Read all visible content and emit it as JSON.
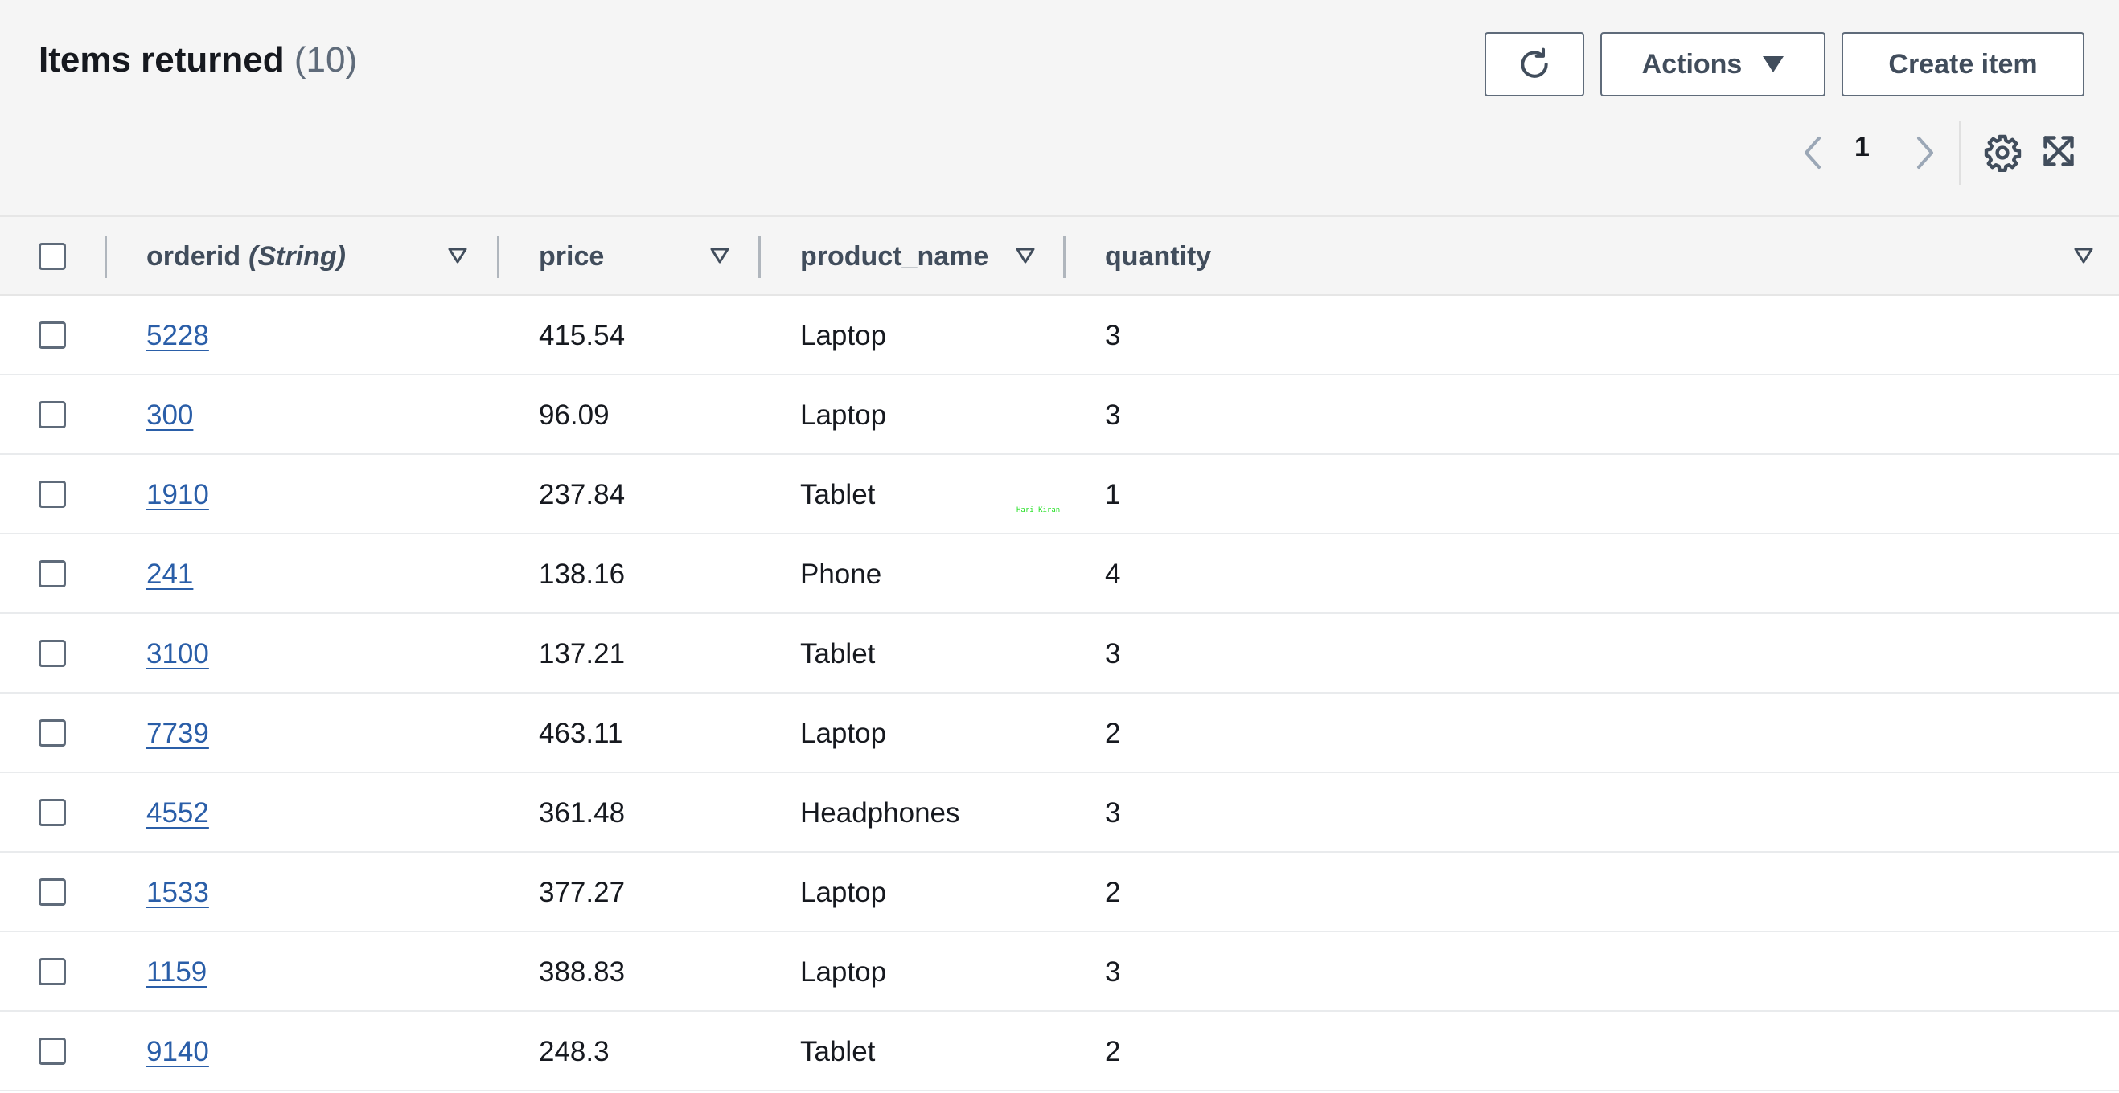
{
  "header": {
    "title": "Items returned",
    "count": "(10)",
    "refresh_icon": "refresh-icon",
    "actions_label": "Actions",
    "create_label": "Create item"
  },
  "pagination": {
    "current_page": "1",
    "prev_icon": "chevron-left-icon",
    "next_icon": "chevron-right-icon",
    "settings_icon": "gear-icon",
    "fullscreen_icon": "expand-icon"
  },
  "table": {
    "columns": [
      {
        "label": "orderid",
        "type": "(String)"
      },
      {
        "label": "price"
      },
      {
        "label": "product_name"
      },
      {
        "label": "quantity"
      }
    ],
    "rows": [
      {
        "orderid": "5228",
        "price": "415.54",
        "product_name": "Laptop",
        "quantity": "3"
      },
      {
        "orderid": "300",
        "price": "96.09",
        "product_name": "Laptop",
        "quantity": "3"
      },
      {
        "orderid": "1910",
        "price": "237.84",
        "product_name": "Tablet",
        "quantity": "1"
      },
      {
        "orderid": "241",
        "price": "138.16",
        "product_name": "Phone",
        "quantity": "4"
      },
      {
        "orderid": "3100",
        "price": "137.21",
        "product_name": "Tablet",
        "quantity": "3"
      },
      {
        "orderid": "7739",
        "price": "463.11",
        "product_name": "Laptop",
        "quantity": "2"
      },
      {
        "orderid": "4552",
        "price": "361.48",
        "product_name": "Headphones",
        "quantity": "3"
      },
      {
        "orderid": "1533",
        "price": "377.27",
        "product_name": "Laptop",
        "quantity": "2"
      },
      {
        "orderid": "1159",
        "price": "388.83",
        "product_name": "Laptop",
        "quantity": "3"
      },
      {
        "orderid": "9140",
        "price": "248.3",
        "product_name": "Tablet",
        "quantity": "2"
      }
    ]
  },
  "watermark": "Hari Kiran",
  "colors": {
    "link": "#2a5ea8",
    "header_bg": "#f5f5f5",
    "watermark": "#22e022"
  }
}
